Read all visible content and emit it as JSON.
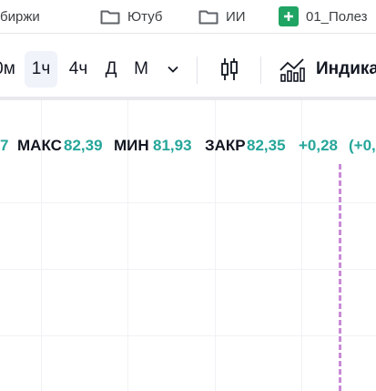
{
  "bookmarks": [
    {
      "label": "биржи",
      "icon": "folder-icon"
    },
    {
      "label": "Ютуб",
      "icon": "folder-icon"
    },
    {
      "label": "ИИ",
      "icon": "folder-icon"
    },
    {
      "label": "01_Полез",
      "icon": "google-sheets-icon"
    }
  ],
  "toolbar": {
    "intervals": [
      "0м",
      "1ч",
      "4ч",
      "Д",
      "М"
    ],
    "active_interval": "1ч",
    "indicators_label": "Индика"
  },
  "legend": {
    "open_tail": "7",
    "high_label": "МАКС",
    "high_value": "82,39",
    "low_label": "МИН",
    "low_value": "81,93",
    "close_label": "ЗАКР",
    "close_value": "82,35",
    "change": "+0,28",
    "change_pct": "(+0,"
  },
  "colors": {
    "value_green": "#26a69a",
    "cursor_line": "#c98bd6",
    "sheets_green": "#1fa463"
  }
}
